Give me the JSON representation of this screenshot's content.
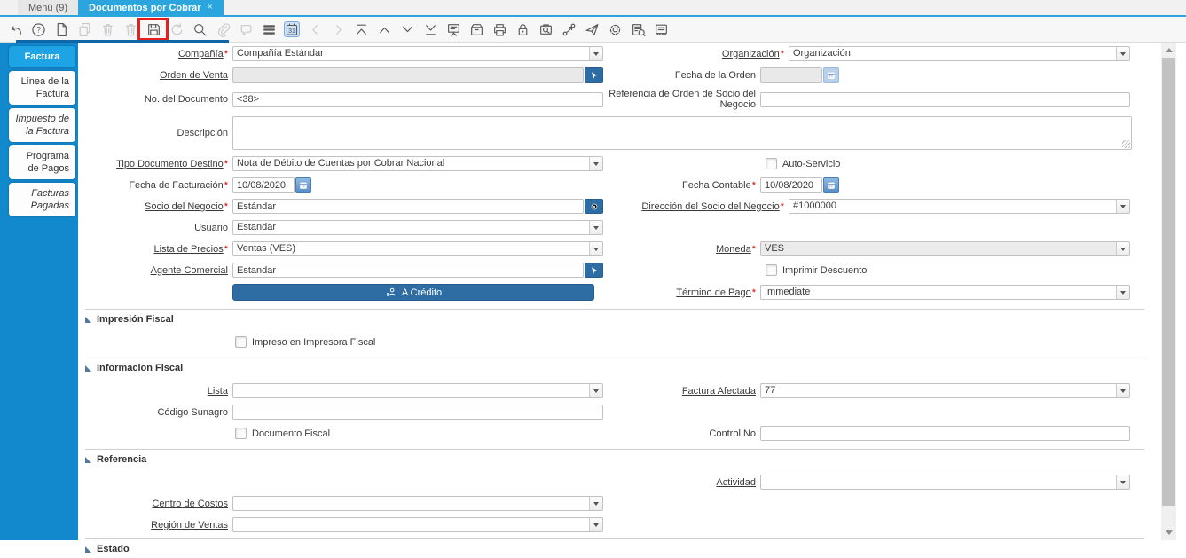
{
  "window": {
    "tabs": [
      {
        "label": "Menú (9)"
      },
      {
        "label": "Documentos por Cobrar",
        "active": true,
        "close_glyph": "×"
      }
    ]
  },
  "toolbar": {
    "calendar_day": "31",
    "save_highlight_color": "#e3201f",
    "icons": [
      {
        "name": "undo",
        "enabled": true
      },
      {
        "name": "help",
        "enabled": true
      },
      {
        "name": "new-record",
        "enabled": true
      },
      {
        "name": "copy-record",
        "enabled": false
      },
      {
        "name": "delete-record",
        "enabled": false
      },
      {
        "name": "delete-selection",
        "enabled": false
      },
      {
        "name": "save",
        "enabled": true,
        "highlighted": true
      },
      {
        "name": "refresh",
        "enabled": false
      },
      {
        "name": "find",
        "enabled": true
      },
      {
        "name": "attachment",
        "enabled": false
      },
      {
        "name": "chat",
        "enabled": false
      },
      {
        "name": "grid-toggle",
        "enabled": true
      },
      {
        "name": "calendar",
        "enabled": true,
        "active": true
      },
      {
        "name": "parent-record",
        "enabled": false
      },
      {
        "name": "detail-record",
        "enabled": false
      },
      {
        "name": "first-record",
        "enabled": true
      },
      {
        "name": "previous-record",
        "enabled": true
      },
      {
        "name": "next-record",
        "enabled": true
      },
      {
        "name": "last-record",
        "enabled": true
      },
      {
        "name": "report",
        "enabled": true
      },
      {
        "name": "archive",
        "enabled": true
      },
      {
        "name": "print",
        "enabled": true
      },
      {
        "name": "lock",
        "enabled": true
      },
      {
        "name": "zoom-across",
        "enabled": true
      },
      {
        "name": "workflow",
        "enabled": true
      },
      {
        "name": "request",
        "enabled": true
      },
      {
        "name": "preferences",
        "enabled": true
      },
      {
        "name": "product-info",
        "enabled": true
      },
      {
        "name": "help-window",
        "enabled": true
      }
    ]
  },
  "sidebar": {
    "tabs": [
      {
        "label": "Factura",
        "active": true
      },
      {
        "label": "Línea de la Factura"
      },
      {
        "label": "Impuesto de la Factura",
        "italic": true
      },
      {
        "label": "Programa de Pagos"
      },
      {
        "label": "Facturas Pagadas",
        "italic": true
      }
    ]
  },
  "form": {
    "compania": {
      "label": "Compañía",
      "required": "*",
      "value": "Compañía Estándar"
    },
    "organizacion": {
      "label": "Organización",
      "required": "*",
      "value": "Organización"
    },
    "orden_de_venta": {
      "label": "Orden de Venta",
      "value": ""
    },
    "fecha_de_la_orden": {
      "label": "Fecha de la Orden",
      "value": ""
    },
    "no_del_documento": {
      "label": "No. del Documento",
      "value": "<38>"
    },
    "referencia_orden_socio": {
      "label": "Referencia de Orden de Socio del Negocio",
      "value": ""
    },
    "descripcion": {
      "label": "Descripción",
      "value": ""
    },
    "tipo_documento_destino": {
      "label": "Tipo Documento Destino",
      "required": "*",
      "value": "Nota de Débito de Cuentas por Cobrar Nacional"
    },
    "auto_servicio": {
      "label": "Auto-Servicio",
      "checked": false
    },
    "fecha_de_facturacion": {
      "label": "Fecha de Facturación",
      "required": "*",
      "value": "10/08/2020"
    },
    "fecha_contable": {
      "label": "Fecha Contable",
      "required": "*",
      "value": "10/08/2020"
    },
    "socio_del_negocio": {
      "label": "Socio del Negocio",
      "required": "*",
      "value": "Estándar"
    },
    "direccion_socio_negocio": {
      "label": "Dirección del Socio del Negocio",
      "required": "*",
      "value": "#1000000"
    },
    "usuario": {
      "label": "Usuario",
      "value": "Estandar"
    },
    "lista_de_precios": {
      "label": "Lista de Precios",
      "required": "*",
      "value": "Ventas (VES)"
    },
    "moneda": {
      "label": "Moneda",
      "required": "*",
      "value": "VES",
      "readonly": true
    },
    "agente_comercial": {
      "label": "Agente Comercial",
      "value": "Estandar"
    },
    "imprimir_descuento": {
      "label": "Imprimir Descuento",
      "checked": false
    },
    "a_credito": {
      "label": "A Crédito"
    },
    "termino_de_pago": {
      "label": "Término de Pago",
      "required": "*",
      "value": "Immediate"
    }
  },
  "sections": {
    "impresion_fiscal": {
      "title": "Impresión Fiscal",
      "impreso_en_impresora_fiscal": {
        "label": "Impreso en Impresora Fiscal",
        "checked": false
      }
    },
    "informacion_fiscal": {
      "title": "Informacion Fiscal",
      "lista": {
        "label": "Lista",
        "value": ""
      },
      "factura_afectada": {
        "label": "Factura Afectada",
        "value": "77"
      },
      "codigo_sunagro": {
        "label": "Código Sunagro",
        "value": ""
      },
      "documento_fiscal": {
        "label": "Documento Fiscal",
        "checked": false
      },
      "control_no": {
        "label": "Control No",
        "value": ""
      }
    },
    "referencia": {
      "title": "Referencia",
      "actividad": {
        "label": "Actividad",
        "value": ""
      },
      "centro_de_costos": {
        "label": "Centro de Costos",
        "value": ""
      },
      "region_de_ventas": {
        "label": "Región de Ventas",
        "value": ""
      }
    },
    "estado": {
      "title": "Estado"
    }
  },
  "colors": {
    "accent_blue": "#2aa5de",
    "sidebar_blue": "#1289cc",
    "active_tab_blue": "#1ea4e4",
    "button_blue": "#2e6da4",
    "highlight_red": "#e3201f",
    "required_red": "#cc0000"
  }
}
